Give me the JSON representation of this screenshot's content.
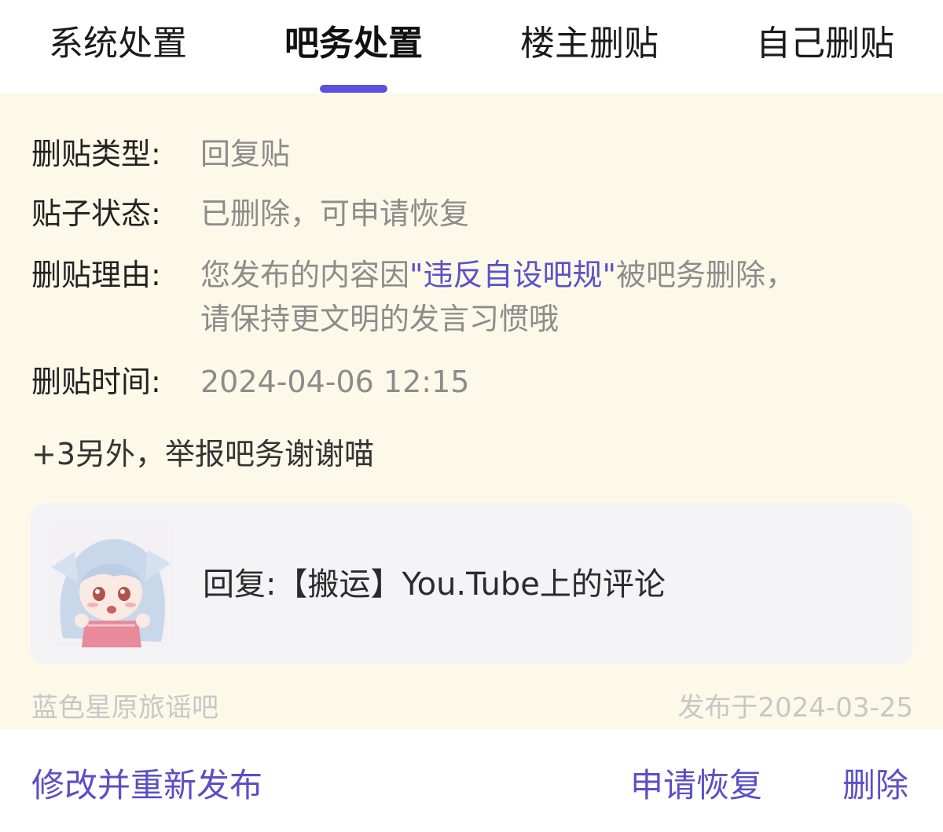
{
  "tabs": [
    {
      "label": "系统处置",
      "active": false
    },
    {
      "label": "吧务处置",
      "active": true
    },
    {
      "label": "楼主删贴",
      "active": false
    },
    {
      "label": "自己删贴",
      "active": false
    }
  ],
  "details": {
    "type_label": "删贴类型:",
    "type_value": "回复贴",
    "status_label": "贴子状态:",
    "status_value": "已删除，可申请恢复",
    "reason_label": "删贴理由:",
    "reason_prefix": "您发布的内容因",
    "reason_highlight": "\"违反自设吧规\"",
    "reason_suffix": "被吧务删除，",
    "reason_line2": "请保持更文明的发言习惯哦",
    "time_label": "删贴时间:",
    "time_value": "2024-04-06 12:15"
  },
  "extra_text": "+3另外，举报吧务谢谢喵",
  "post": {
    "title": "回复:【搬运】You.Tube上的评论",
    "thumbnail_icon": "anime-avatar-thumbnail"
  },
  "footer_meta": {
    "forum_name": "蓝色星原旅谣吧",
    "publish_date": "发布于2024-03-25"
  },
  "actions": {
    "edit_republish": "修改并重新发布",
    "apply_restore": "申请恢复",
    "delete": "删除"
  },
  "colors": {
    "accent": "#5b50e0",
    "card_bg": "#fcf9e9",
    "preview_bg": "#f4f4f6"
  }
}
